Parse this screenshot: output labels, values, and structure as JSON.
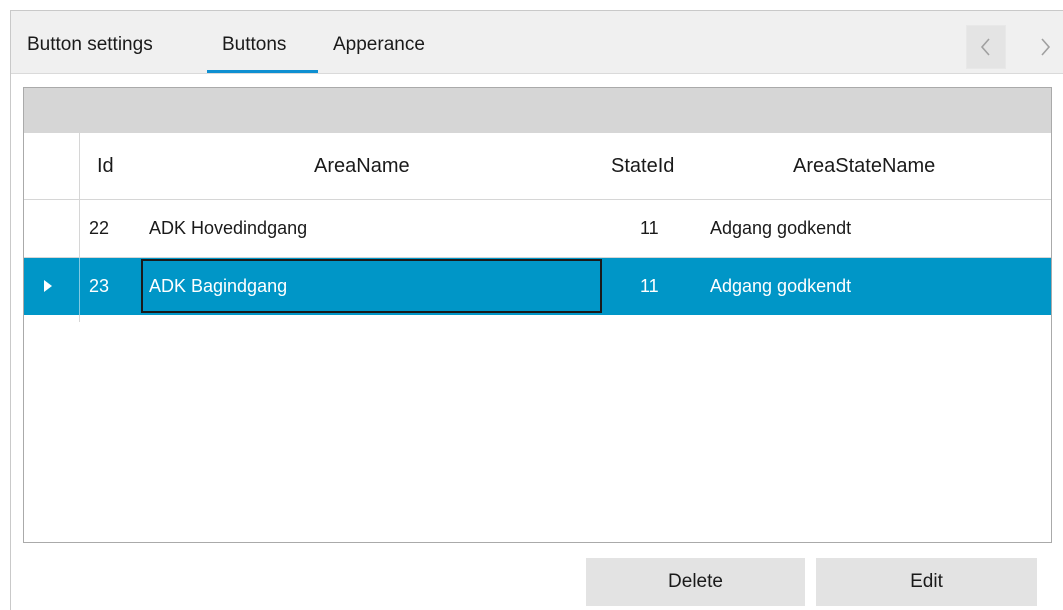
{
  "tabs": [
    {
      "label": "Button settings"
    },
    {
      "label": "Buttons"
    },
    {
      "label": "Apperance"
    }
  ],
  "active_tab": "Buttons",
  "nav": {
    "prev_icon": "chevron-left-icon",
    "next_icon": "chevron-right-icon"
  },
  "grid": {
    "columns": [
      "Id",
      "AreaName",
      "StateId",
      "AreaStateName"
    ],
    "rows": [
      {
        "id": "22",
        "area_name": "ADK Hovedindgang",
        "state_id": "11",
        "area_state_name": "Adgang godkendt"
      },
      {
        "id": "23",
        "area_name": "ADK Bagindgang",
        "state_id": "11",
        "area_state_name": "Adgang godkendt"
      }
    ],
    "selected_row": 1
  },
  "buttons": {
    "delete": "Delete",
    "edit": "Edit"
  },
  "colors": {
    "accent": "#0e8fd1",
    "selection": "#0096c7"
  }
}
